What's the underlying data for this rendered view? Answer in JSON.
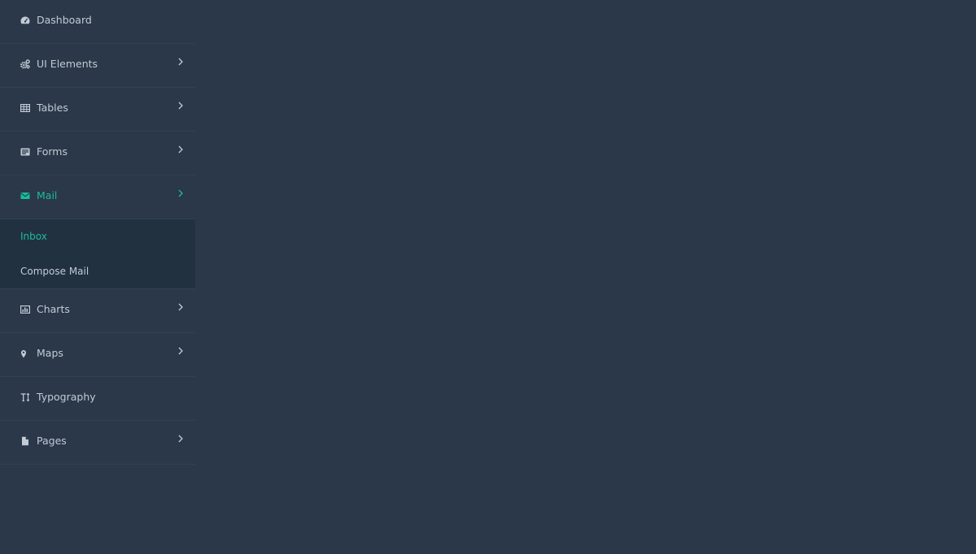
{
  "sidebar": {
    "items": [
      {
        "label": "Dashboard",
        "icon": "dashboard-icon"
      },
      {
        "label": "UI Elements",
        "icon": "cogs-icon"
      },
      {
        "label": "Tables",
        "icon": "table-icon"
      },
      {
        "label": "Forms",
        "icon": "forms-icon"
      },
      {
        "label": "Mail",
        "icon": "envelope-icon"
      },
      {
        "label": "Charts",
        "icon": "bar-chart-icon"
      },
      {
        "label": "Maps",
        "icon": "map-marker-icon"
      },
      {
        "label": "Typography",
        "icon": "text-height-icon"
      },
      {
        "label": "Pages",
        "icon": "file-icon"
      }
    ],
    "mail_submenu": [
      {
        "label": "Inbox"
      },
      {
        "label": "Compose Mail"
      }
    ]
  },
  "colors": {
    "background": "#2a3849",
    "accent": "#1abc9c",
    "text": "#c2cbd5",
    "submenu_background": "#223140",
    "divider": "#324153"
  }
}
